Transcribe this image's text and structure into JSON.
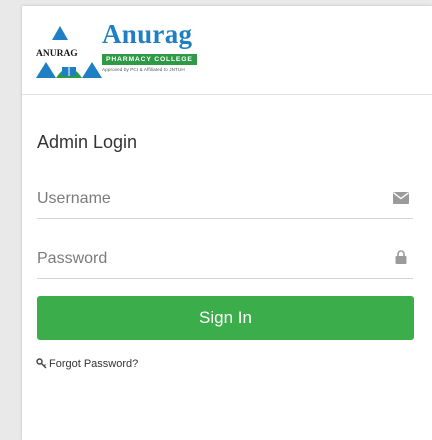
{
  "brand": {
    "logo_text": "ANURAG",
    "name": "Anurag",
    "subtitle": "PHARMACY COLLEGE",
    "approval": "Approved by PCI & Affiliated to JNTUH",
    "primary_color": "#1e7fc2",
    "accent_color": "#2f9a45"
  },
  "login": {
    "title": "Admin Login",
    "username_label": "Username",
    "username_icon": "envelope-icon",
    "password_label": "Password",
    "password_icon": "lock-icon",
    "signin_label": "Sign In",
    "button_color": "#3cad4b",
    "forgot_icon": "key-icon",
    "forgot_label": "Forgot Password?"
  }
}
